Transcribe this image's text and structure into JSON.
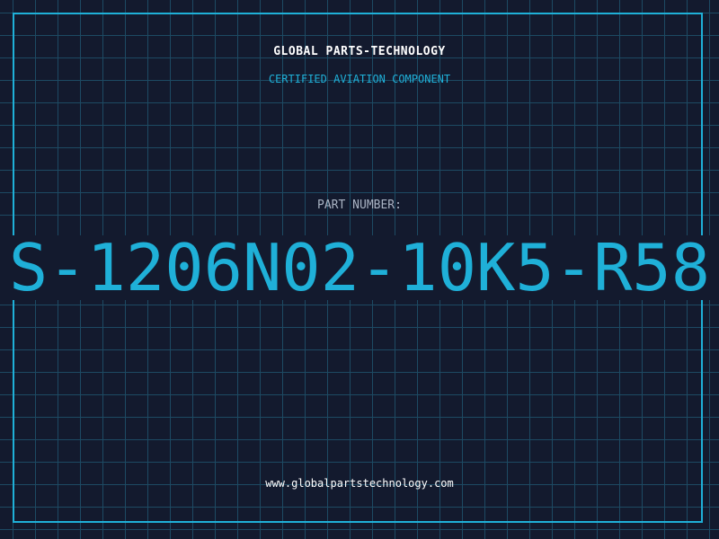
{
  "header": {
    "company": "GLOBAL PARTS-TECHNOLOGY",
    "tagline": "CERTIFIED AVIATION COMPONENT"
  },
  "part": {
    "label": "PART NUMBER:",
    "number": "S-1206N02-10K5-R58"
  },
  "footer": {
    "website": "www.globalpartstechnology.com"
  },
  "colors": {
    "background": "#131a2e",
    "grid": "#1d4a63",
    "accent": "#1fb0d8",
    "text": "#ffffff",
    "label": "#aab4c4"
  }
}
